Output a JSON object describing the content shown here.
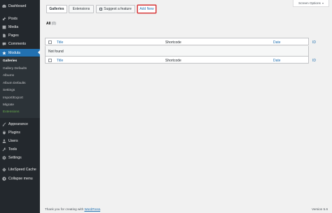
{
  "sidebar": {
    "items": [
      {
        "label": "Dashboard",
        "icon": "dashboard-icon"
      },
      {
        "label": "Posts",
        "icon": "pin-icon"
      },
      {
        "label": "Media",
        "icon": "media-icon"
      },
      {
        "label": "Pages",
        "icon": "page-icon"
      },
      {
        "label": "Comments",
        "icon": "comment-icon"
      },
      {
        "label": "Modula",
        "icon": "modula-icon"
      }
    ],
    "submenu": [
      {
        "label": "Galleries"
      },
      {
        "label": "Gallery Defaults"
      },
      {
        "label": "Albums"
      },
      {
        "label": "Album Defaults"
      },
      {
        "label": "Settings"
      },
      {
        "label": "Import/Export"
      },
      {
        "label": "Migrate"
      },
      {
        "label": "Extensions"
      }
    ],
    "items_bottom": [
      {
        "label": "Appearance",
        "icon": "brush-icon"
      },
      {
        "label": "Plugins",
        "icon": "plugin-icon"
      },
      {
        "label": "Users",
        "icon": "users-icon"
      },
      {
        "label": "Tools",
        "icon": "wrench-icon"
      },
      {
        "label": "Settings",
        "icon": "settings-icon"
      },
      {
        "label": "LiteSpeed Cache",
        "icon": "litespeed-icon"
      },
      {
        "label": "Collapse menu",
        "icon": "collapse-icon"
      }
    ]
  },
  "screen_options": {
    "label": "Screen Options"
  },
  "tabs": [
    {
      "label": "Galleries"
    },
    {
      "label": "Extensions"
    },
    {
      "label": "Suggest a feature"
    },
    {
      "label": "Add New"
    }
  ],
  "filter": {
    "all_label": "All",
    "count": "(0)"
  },
  "table": {
    "columns": [
      "Title",
      "Shortcode",
      "Date",
      "ID"
    ],
    "empty_message": "Not found"
  },
  "footer": {
    "thanks_prefix": "Thank you for creating with ",
    "wordpress_link": "WordPress",
    "thanks_suffix": ".",
    "version": "Version 5.6"
  },
  "colors": {
    "sidebar_bg": "#23282d",
    "accent": "#2271b1",
    "highlight_border": "#d63638",
    "extensions_green": "#6ab04c"
  }
}
